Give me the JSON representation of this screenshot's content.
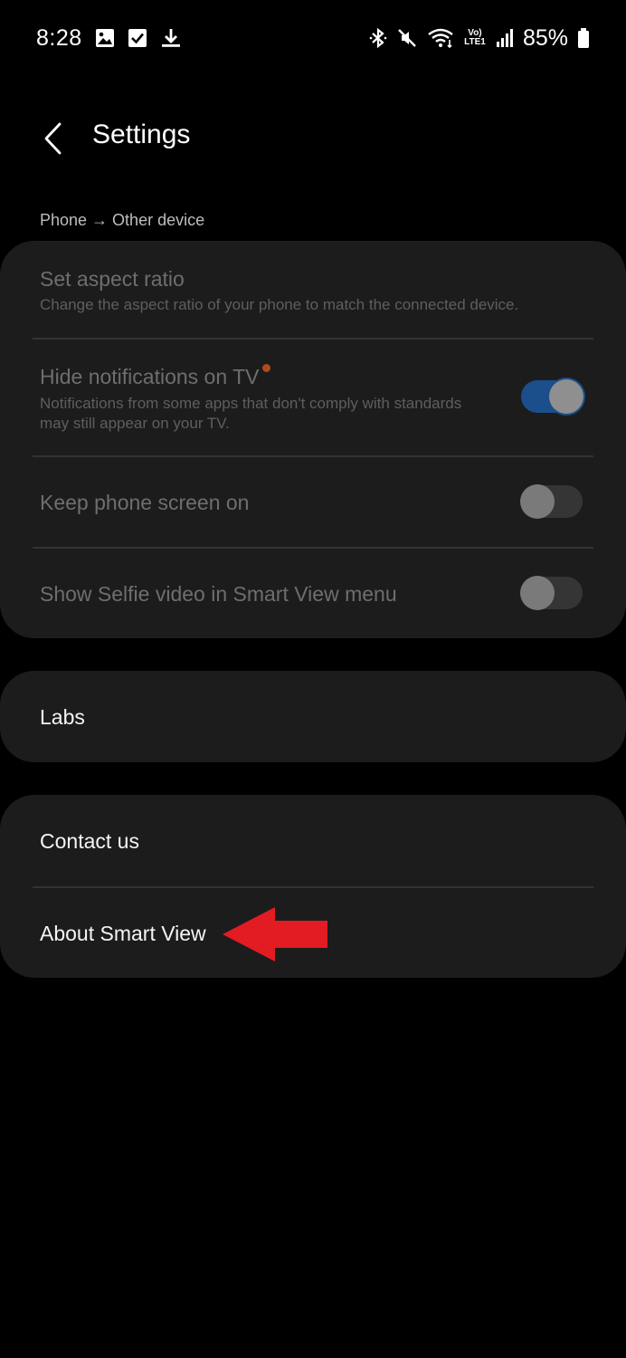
{
  "status_bar": {
    "time": "8:28",
    "battery": "85%",
    "network_label": "Vo) LTE1",
    "left_icons": [
      "gallery-icon",
      "checkbox-icon",
      "download-icon"
    ],
    "right_icons": [
      "bluetooth-icon",
      "mute-icon",
      "wifi-icon",
      "volte-icon",
      "signal-icon",
      "battery-icon"
    ]
  },
  "header": {
    "title": "Settings",
    "back_icon": "chevron-left-icon"
  },
  "section": {
    "caption": "Phone → Other device"
  },
  "group1": {
    "items": [
      {
        "title": "Set aspect ratio",
        "subtitle": "Change the aspect ratio of your phone to match the connected device.",
        "enabled": false
      },
      {
        "title": "Hide notifications on TV",
        "subtitle": "Notifications from some apps that don't comply with standards may still appear on your TV.",
        "toggle": true,
        "has_badge_dot": true,
        "enabled": false
      },
      {
        "title": "Keep phone screen on",
        "toggle": false,
        "enabled": false
      },
      {
        "title": "Show Selfie video in Smart View menu",
        "toggle": false,
        "enabled": false
      }
    ]
  },
  "group2": {
    "items": [
      {
        "title": "Labs"
      }
    ]
  },
  "group3": {
    "items": [
      {
        "title": "Contact us"
      },
      {
        "title": "About Smart View"
      }
    ]
  },
  "colors": {
    "background": "#000000",
    "card": "#1c1c1c",
    "toggle_on": "#1b4f8b",
    "annotation_arrow": "#e31b23",
    "badge_dot": "#b04a1e"
  }
}
